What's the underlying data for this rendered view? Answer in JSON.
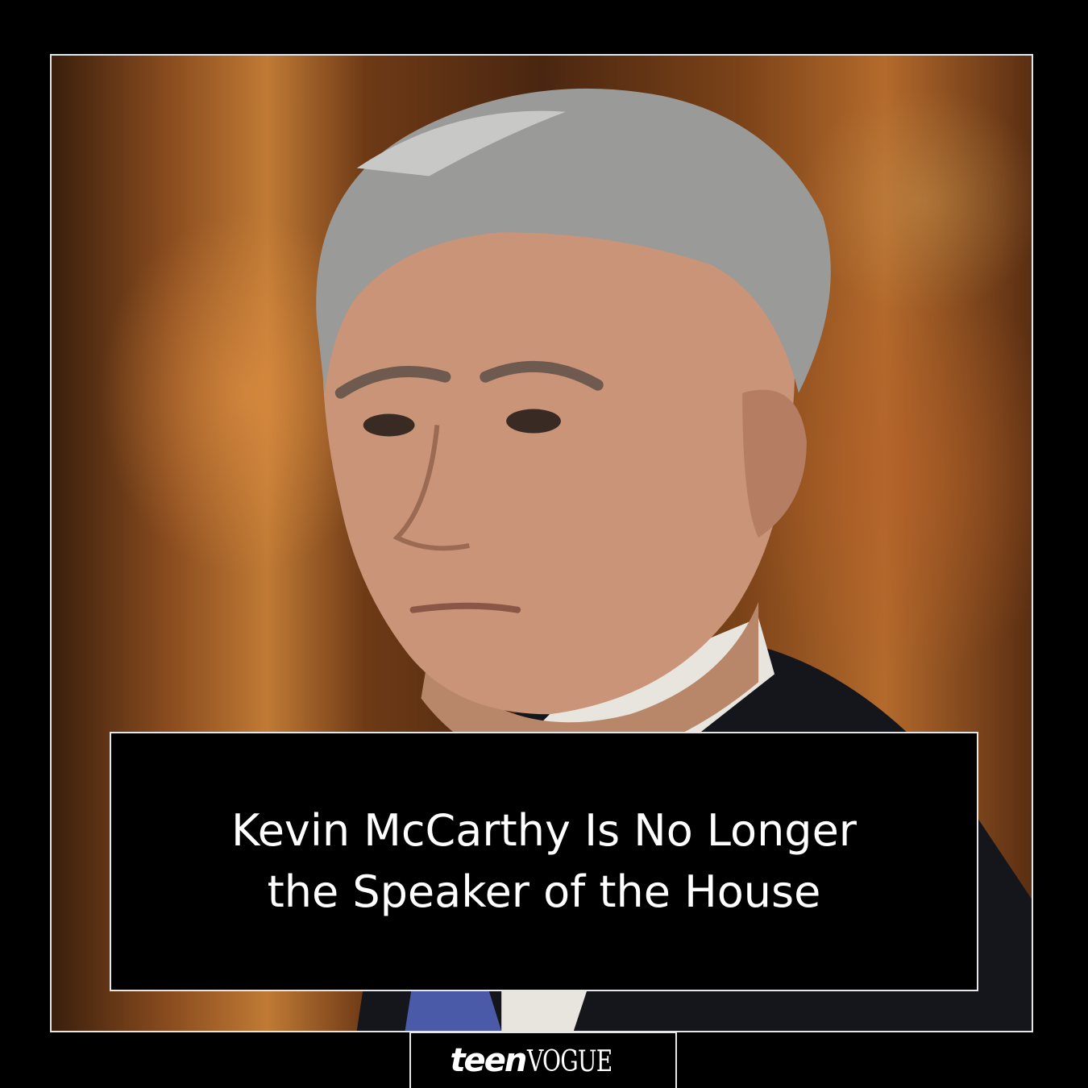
{
  "headline": {
    "line1": "Kevin McCarthy Is No Longer",
    "line2": "the Speaker of the House"
  },
  "brand": {
    "teen": "teen",
    "vogue": "VOGUE"
  },
  "colors": {
    "background": "#000000",
    "frame": "#e6e6e6",
    "text": "#ffffff"
  }
}
